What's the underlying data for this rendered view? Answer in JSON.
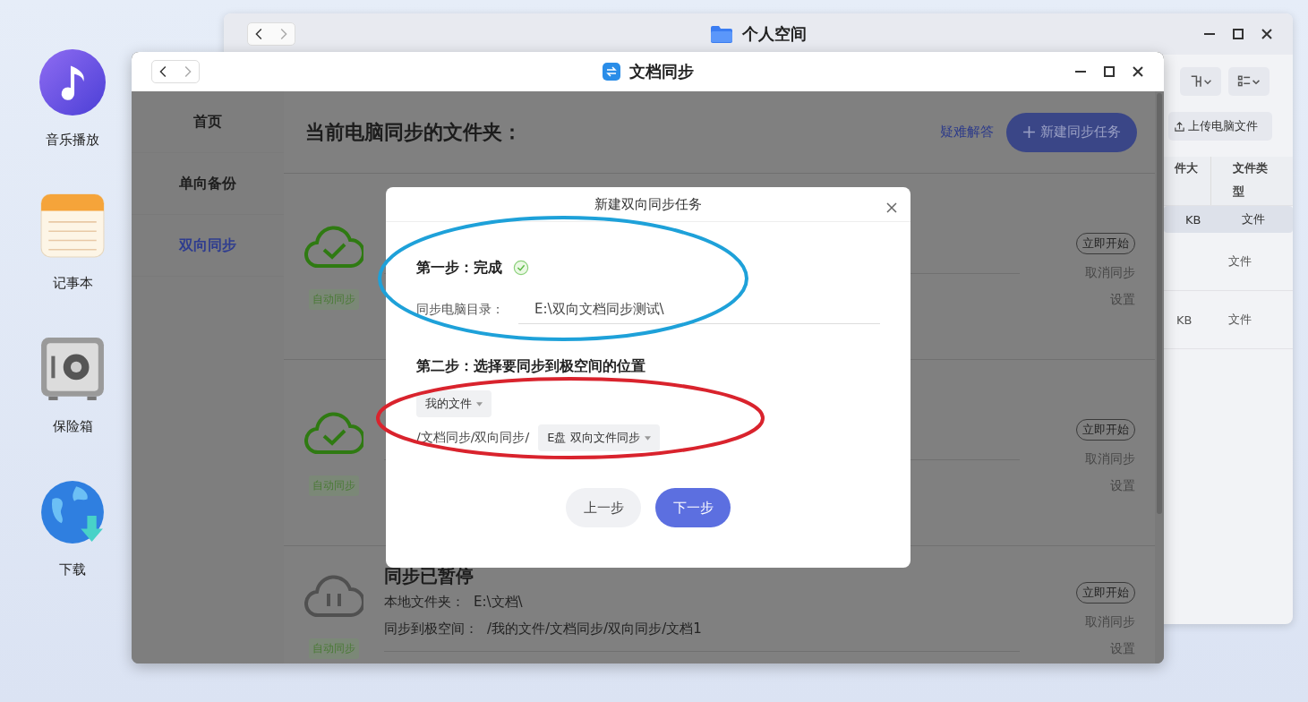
{
  "desktop": {
    "icons": [
      {
        "label": "音乐播放",
        "kind": "music"
      },
      {
        "label": "记事本",
        "kind": "notes"
      },
      {
        "label": "保险箱",
        "kind": "safe"
      },
      {
        "label": "下载",
        "kind": "download"
      }
    ]
  },
  "back_window": {
    "title": "个人空间",
    "upload_button": "上传电脑文件",
    "columns": [
      "件大",
      "文件类型"
    ],
    "rows": [
      {
        "size": "KB",
        "type": "文件",
        "selected": true
      },
      {
        "type": "文件",
        "selected": false
      },
      {
        "size": "KB",
        "type": "文件",
        "selected": false
      }
    ]
  },
  "front_window": {
    "title": "文档同步",
    "sidebar": [
      {
        "label": "首页",
        "selected": false
      },
      {
        "label": "单向备份",
        "selected": false
      },
      {
        "label": "双向同步",
        "selected": true
      }
    ],
    "heading": "当前电脑同步的文件夹：",
    "help_link": "疑难解答",
    "new_task_button": "新建同步任务",
    "tasks": [
      {
        "kind": "synced",
        "tag": "自动同步",
        "actions": [
          "立即开始",
          "取消同步",
          "设置"
        ]
      },
      {
        "kind": "synced",
        "tag": "自动同步",
        "actions": [
          "立即开始",
          "取消同步",
          "设置"
        ]
      },
      {
        "kind": "paused",
        "tag": "自动同步",
        "title": "同步已暂停",
        "actions": [
          "立即开始",
          "取消同步",
          "设置"
        ],
        "lines": [
          {
            "label": "本地文件夹：",
            "value": "E:\\文档\\"
          },
          {
            "label": "同步到极空间：",
            "value": "/我的文件/文档同步/双向同步/文档1"
          }
        ]
      }
    ]
  },
  "dialog": {
    "title": "新建双向同步任务",
    "step1": {
      "heading": "第一步：完成",
      "done": true,
      "label": "同步电脑目录：",
      "value": "E:\\双向文档同步测试\\"
    },
    "step2": {
      "heading": "第二步：选择要同步到极空间的位置",
      "root_select": "我的文件",
      "path": "/文档同步/双向同步/",
      "folder_select": "E盘 双向文件同步"
    },
    "buttons": [
      {
        "label": "上一步",
        "kind": "secondary"
      },
      {
        "label": "下一步",
        "kind": "primary"
      }
    ]
  },
  "annotations": [
    {
      "color": "#1ea1d9"
    },
    {
      "color": "#d9232d"
    }
  ]
}
